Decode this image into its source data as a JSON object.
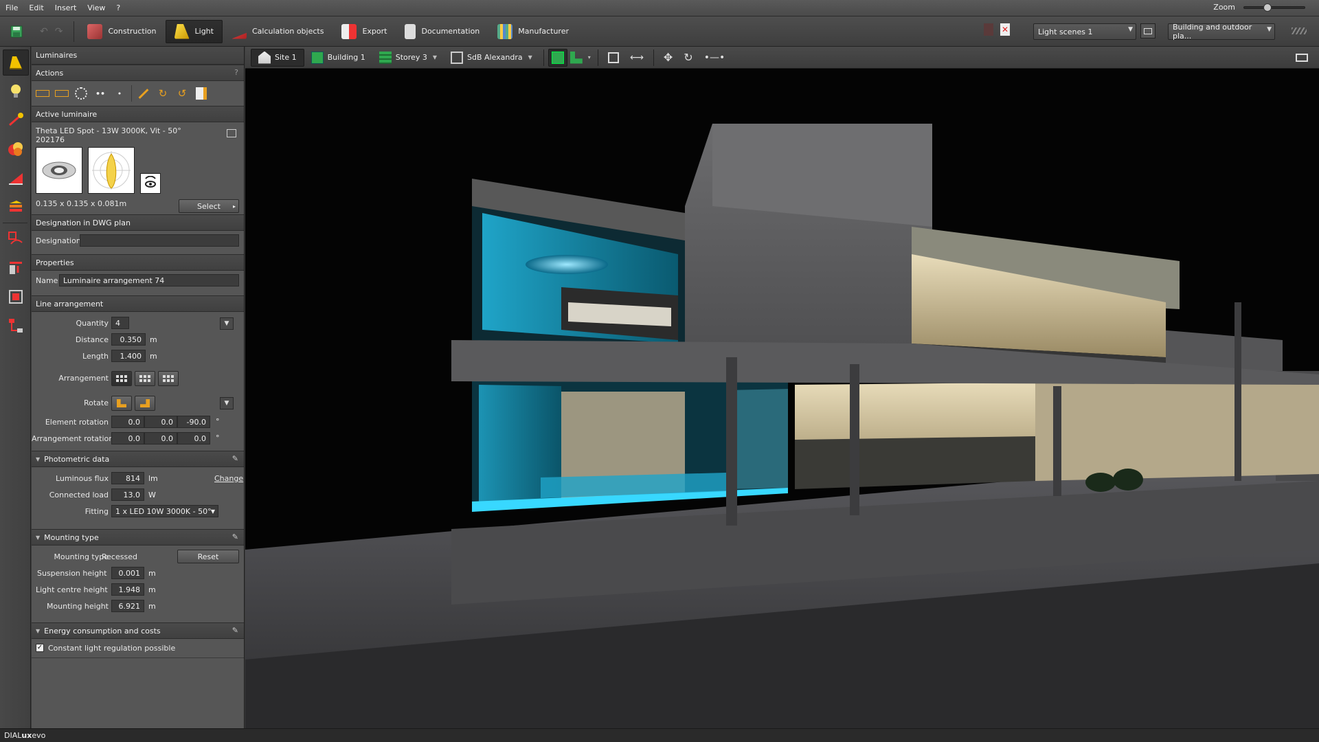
{
  "menu": [
    "File",
    "Edit",
    "Insert",
    "View",
    "?"
  ],
  "zoom_label": "Zoom",
  "toolbar": {
    "tabs": [
      "Construction",
      "Light",
      "Calculation objects",
      "Export",
      "Documentation",
      "Manufacturer"
    ],
    "active_tab": "Light",
    "light_scene": "Light scenes 1",
    "view_mode": "Building and outdoor pla..."
  },
  "view_toolbar": {
    "site": "Site 1",
    "building": "Building 1",
    "storey": "Storey 3",
    "room": "SdB Alexandra"
  },
  "panel": {
    "title": "Luminaires",
    "actions_header": "Actions",
    "actions_help": "?",
    "active_luminaire_header": "Active luminaire",
    "luminaire_name": "Theta LED Spot - 13W 3000K, Vit - 50°",
    "luminaire_code": "202176",
    "luminaire_dims": "0.135 x 0.135 x 0.081m",
    "select_button": "Select",
    "designation_header": "Designation in DWG plan",
    "designation_label": "Designation",
    "designation_value": "",
    "properties_header": "Properties",
    "name_label": "Name",
    "name_value": "Luminaire arrangement 74",
    "line_header": "Line arrangement",
    "quantity_label": "Quantity",
    "quantity_value": "4",
    "distance_label": "Distance",
    "distance_value": "0.350",
    "length_label": "Length",
    "length_value": "1.400",
    "unit_m": "m",
    "arrangement_label": "Arrangement",
    "rotate_label": "Rotate",
    "element_rotation_label": "Element rotation",
    "element_rotation": [
      "0.0",
      "0.0",
      "-90.0"
    ],
    "arrangement_rotation_label": "Arrangement rotation",
    "arrangement_rotation": [
      "0.0",
      "0.0",
      "0.0"
    ],
    "degree": "°",
    "photometric_header": "Photometric data",
    "luminous_flux_label": "Luminous flux",
    "luminous_flux_value": "814",
    "luminous_flux_unit": "lm",
    "change_link": "Change",
    "connected_load_label": "Connected load",
    "connected_load_value": "13.0",
    "connected_load_unit": "W",
    "fitting_label": "Fitting",
    "fitting_value": "1 x LED 10W 3000K - 50°",
    "mounting_header": "Mounting type",
    "mounting_type_label": "Mounting type",
    "mounting_type_value": "Recessed",
    "reset_button": "Reset",
    "suspension_label": "Suspension height",
    "suspension_value": "0.001",
    "light_centre_label": "Light centre height",
    "light_centre_value": "1.948",
    "mounting_height_label": "Mounting height",
    "mounting_height_value": "6.921",
    "energy_header": "Energy consumption and costs",
    "constant_light_label": "Constant light regulation possible",
    "constant_light_checked": true
  },
  "status": {
    "app_a": "DIAL",
    "app_b": "ux",
    "app_c": "evo"
  },
  "colors": {
    "accent_yellow": "#f2c200",
    "cyan_light": "#38d8ff",
    "warm_light": "#f2e6c4"
  }
}
